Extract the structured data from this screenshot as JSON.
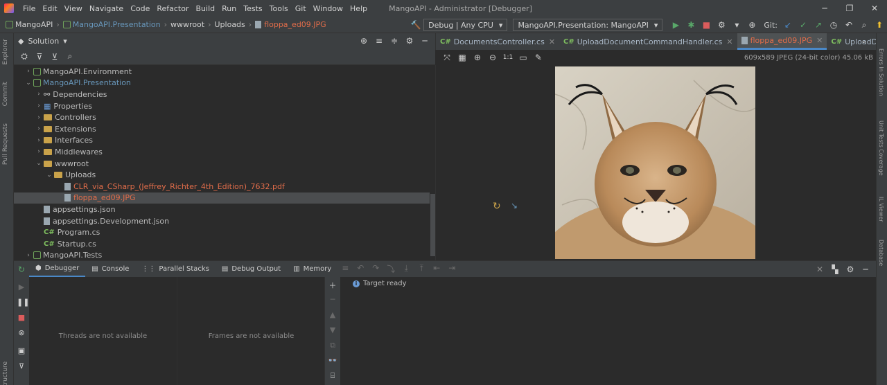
{
  "menubar": {
    "items": [
      "File",
      "Edit",
      "View",
      "Navigate",
      "Code",
      "Refactor",
      "Build",
      "Run",
      "Tests",
      "Tools",
      "Git",
      "Window",
      "Help"
    ],
    "window_title": "MangoAPI - Administrator [Debugger]"
  },
  "breadcrumb": {
    "root": "MangoAPI",
    "project": "MangoAPI.Presentation",
    "folder1": "wwwroot",
    "folder2": "Uploads",
    "file": "floppa_ed09.JPG"
  },
  "run_config": {
    "build_config": "Debug | Any CPU",
    "startup": "MangoAPI.Presentation: MangoAPI",
    "git_label": "Git:"
  },
  "solution": {
    "header_title": "Solution",
    "tree": [
      {
        "label": "MangoAPI.Environment",
        "indent": 0,
        "arrow": "›",
        "icon": "project",
        "style": ""
      },
      {
        "label": "MangoAPI.Presentation",
        "indent": 0,
        "arrow": "⌄",
        "icon": "project",
        "style": "blue"
      },
      {
        "label": "Dependencies",
        "indent": 1,
        "arrow": "›",
        "icon": "deps",
        "style": ""
      },
      {
        "label": "Properties",
        "indent": 1,
        "arrow": "›",
        "icon": "props",
        "style": ""
      },
      {
        "label": "Controllers",
        "indent": 1,
        "arrow": "›",
        "icon": "folder",
        "style": ""
      },
      {
        "label": "Extensions",
        "indent": 1,
        "arrow": "›",
        "icon": "folder",
        "style": ""
      },
      {
        "label": "Interfaces",
        "indent": 1,
        "arrow": "›",
        "icon": "folder",
        "style": ""
      },
      {
        "label": "Middlewares",
        "indent": 1,
        "arrow": "›",
        "icon": "folder",
        "style": ""
      },
      {
        "label": "wwwroot",
        "indent": 1,
        "arrow": "⌄",
        "icon": "folder",
        "style": ""
      },
      {
        "label": "Uploads",
        "indent": 2,
        "arrow": "⌄",
        "icon": "folder",
        "style": ""
      },
      {
        "label": "CLR_via_CSharp_(Jeffrey_Richter_4th_Edition)_7632.pdf",
        "indent": 3,
        "arrow": "",
        "icon": "file",
        "style": "orange"
      },
      {
        "label": "floppa_ed09.JPG",
        "indent": 3,
        "arrow": "",
        "icon": "file",
        "style": "orange",
        "selected": true
      },
      {
        "label": "appsettings.json",
        "indent": 1,
        "arrow": "",
        "icon": "json",
        "style": ""
      },
      {
        "label": "appsettings.Development.json",
        "indent": 1,
        "arrow": "",
        "icon": "json",
        "style": ""
      },
      {
        "label": "Program.cs",
        "indent": 1,
        "arrow": "",
        "icon": "cs",
        "style": ""
      },
      {
        "label": "Startup.cs",
        "indent": 1,
        "arrow": "",
        "icon": "cs",
        "style": ""
      },
      {
        "label": "MangoAPI.Tests",
        "indent": 0,
        "arrow": "›",
        "icon": "project",
        "style": ""
      }
    ]
  },
  "editor_tabs": [
    {
      "label": "DocumentsController.cs",
      "cs": true,
      "active": false
    },
    {
      "label": "UploadDocumentCommandHandler.cs",
      "cs": true,
      "active": false
    },
    {
      "label": "floppa_ed09.JPG",
      "cs": false,
      "active": true
    },
    {
      "label": "UploadDocumentComma",
      "cs": true,
      "active": false
    }
  ],
  "image_viewer": {
    "zoom_label": "1:1",
    "info": "609x589 JPEG (24-bit color) 45.06 kB"
  },
  "debug_tabs": [
    {
      "label": "Debugger",
      "active": true
    },
    {
      "label": "Console",
      "active": false
    },
    {
      "label": "Parallel Stacks",
      "active": false
    },
    {
      "label": "Debug Output",
      "active": false
    },
    {
      "label": "Memory",
      "active": false
    }
  ],
  "debugger": {
    "threads_msg": "Threads are not available",
    "frames_msg": "Frames are not available",
    "console_line": "Target ready"
  },
  "side_tabs": {
    "left": [
      "Explorer",
      "Commit",
      "Pull Requests",
      "Structure"
    ],
    "right": [
      "Errors In Solution",
      "Unit Tests Coverage",
      "IL Viewer",
      "Database"
    ]
  }
}
